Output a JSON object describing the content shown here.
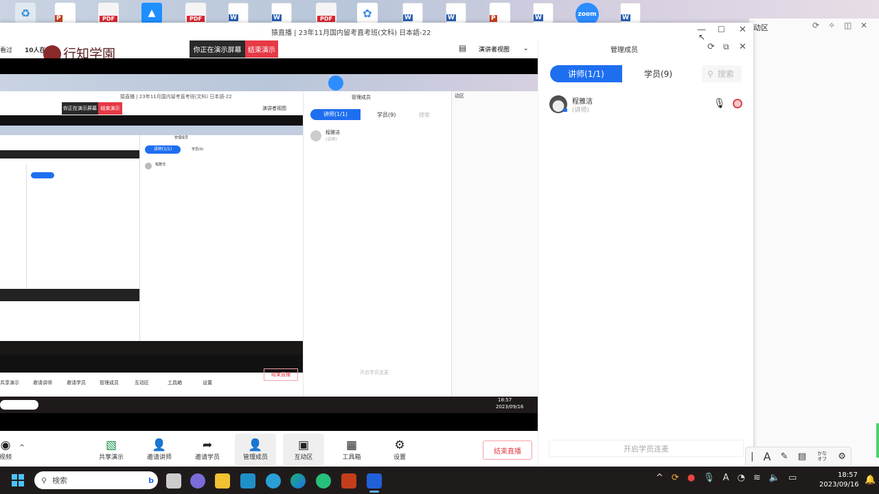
{
  "window": {
    "title": "猿直播 | 23年11月国内留考直考班(文科) 日本語-22"
  },
  "header": {
    "watched": "看过",
    "online": "10人在线",
    "logo": "行知学園",
    "presenting": "你正在演示屏幕",
    "end_present": "结束演示",
    "view_mode": "演讲者视图"
  },
  "members": {
    "title": "管理成员",
    "tab_teacher": "讲师(1/1)",
    "tab_student": "学员(9)",
    "search_placeholder": "搜索",
    "member_name": "程雅洁",
    "member_role": "(讲师)",
    "enable_mic": "开启学员连麦"
  },
  "interaction": {
    "title": "动区"
  },
  "toolbar": {
    "video": "视频",
    "share": "共享演示",
    "invite_teacher": "邀请讲师",
    "invite_student": "邀请学员",
    "manage": "管理成员",
    "interact": "互动区",
    "tools": "工具箱",
    "settings": "设置",
    "end_live": "结束直播"
  },
  "ime": {
    "mode": "A",
    "kana": "かな オフ"
  },
  "taskbar": {
    "search": "検索",
    "time": "18:57",
    "date": "2023/09/16"
  },
  "desktop": {
    "zoom_label": "zoom"
  }
}
